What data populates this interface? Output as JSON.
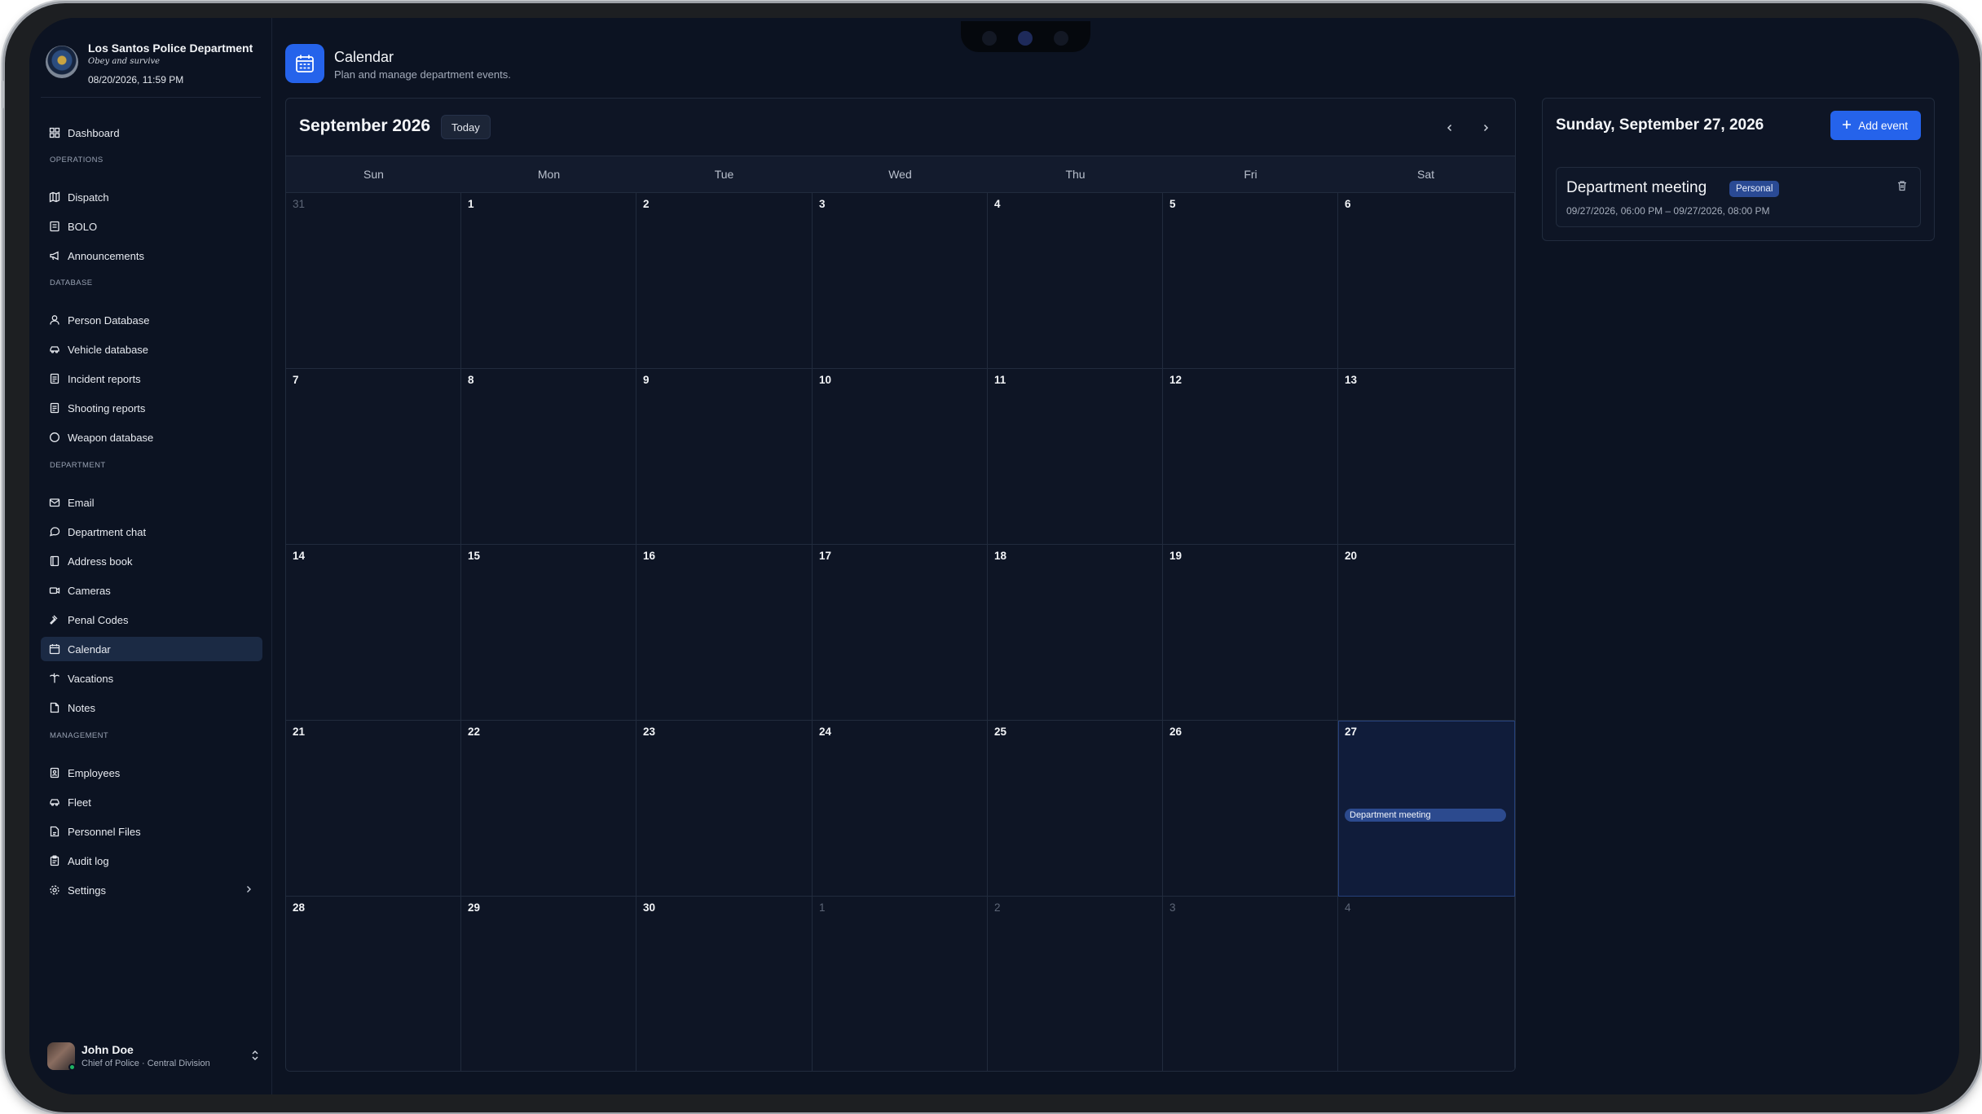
{
  "org": {
    "name": "Los Santos Police Department",
    "motto": "Obey and survive",
    "datetime": "08/20/2026, 11:59 PM"
  },
  "nav": {
    "dashboard": "Dashboard",
    "sections": {
      "operations": "Operations",
      "database": "Database",
      "department": "Department",
      "management": "Management"
    },
    "operations": [
      "Dispatch",
      "BOLO",
      "Announcements"
    ],
    "database": [
      "Person Database",
      "Vehicle database",
      "Incident reports",
      "Shooting reports",
      "Weapon database"
    ],
    "department": [
      "Email",
      "Department chat",
      "Address book",
      "Cameras",
      "Penal Codes",
      "Calendar",
      "Vacations",
      "Notes"
    ],
    "management": [
      "Employees",
      "Fleet",
      "Personnel Files",
      "Audit log",
      "Settings"
    ],
    "active": "Calendar"
  },
  "user": {
    "name": "John Doe",
    "role": "Chief of Police · Central Division"
  },
  "page": {
    "title": "Calendar",
    "subtitle": "Plan and manage department events."
  },
  "calendar": {
    "month_label": "September 2026",
    "today_label": "Today",
    "weekdays": [
      "Sun",
      "Mon",
      "Tue",
      "Wed",
      "Thu",
      "Fri",
      "Sat"
    ],
    "weeks": [
      [
        "31",
        "1",
        "2",
        "3",
        "4",
        "5",
        "6"
      ],
      [
        "7",
        "8",
        "9",
        "10",
        "11",
        "12",
        "13"
      ],
      [
        "14",
        "15",
        "16",
        "17",
        "18",
        "19",
        "20"
      ],
      [
        "21",
        "22",
        "23",
        "24",
        "25",
        "26",
        "27"
      ],
      [
        "28",
        "29",
        "30",
        "1",
        "2",
        "3",
        "4"
      ]
    ],
    "selected_day": "27",
    "event_chip": "Department meeting"
  },
  "day_panel": {
    "date_label": "Sunday, September 27, 2026",
    "add_label": "Add event",
    "event": {
      "title": "Department meeting",
      "badge": "Personal",
      "time": "09/27/2026, 06:00 PM – 09/27/2026, 08:00 PM"
    }
  },
  "colors": {
    "background": "#0c1322",
    "accent": "#2563eb",
    "event_chip": "#2c4a8e"
  }
}
